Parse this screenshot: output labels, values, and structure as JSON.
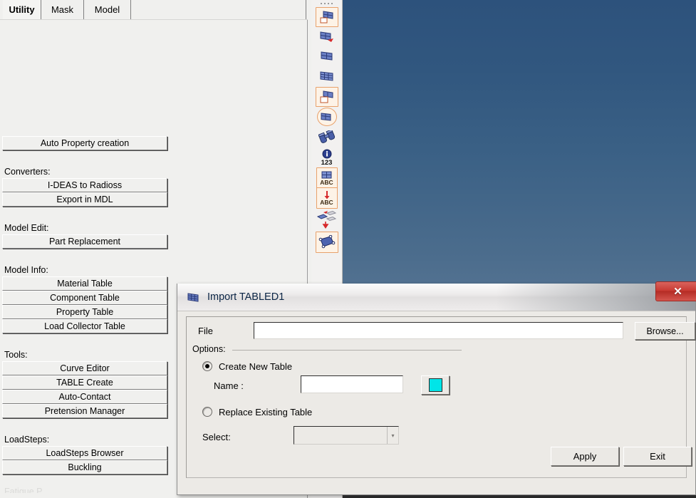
{
  "tabs": [
    {
      "label": "Utility",
      "active": true
    },
    {
      "label": "Mask",
      "active": false
    },
    {
      "label": "Model",
      "active": false
    }
  ],
  "left_panel": {
    "auto_property_button": "Auto Property creation",
    "sections": [
      {
        "label": "Converters:",
        "buttons": [
          "I-DEAS to Radioss",
          "Export in MDL"
        ]
      },
      {
        "label": "Model Edit:",
        "buttons": [
          "Part Replacement"
        ]
      },
      {
        "label": "Model Info:",
        "buttons": [
          "Material Table",
          "Component Table",
          "Property Table",
          "Load Collector Table"
        ]
      },
      {
        "label": "Tools:",
        "buttons": [
          "Curve Editor",
          "TABLE Create",
          "Auto-Contact",
          "Pretension Manager"
        ]
      },
      {
        "label": "LoadSteps:",
        "buttons": [
          "LoadSteps Browser",
          "Buckling"
        ]
      }
    ],
    "clipped_section_label": "Fatigue P"
  },
  "toolbar": {
    "items": [
      {
        "name": "table-create-icon"
      },
      {
        "name": "table-import-icon"
      },
      {
        "name": "table-edit-icon"
      },
      {
        "name": "table-grid-icon"
      },
      {
        "name": "table-delete-icon"
      },
      {
        "name": "table-review-icon"
      },
      {
        "name": "binoculars-icon"
      },
      {
        "name": "info-123-icon"
      },
      {
        "name": "abc-label-icon"
      },
      {
        "name": "abc-arrow-icon"
      },
      {
        "name": "transform-icon"
      },
      {
        "name": "quad-element-icon"
      }
    ],
    "info_number_label": "123",
    "abc_label": "ABC"
  },
  "dialog": {
    "title": "Import TABLED1",
    "title_icon": "table-grid-icon",
    "close_label": "✕",
    "file": {
      "label": "File",
      "value": "",
      "placeholder": "",
      "browse_label": "Browse..."
    },
    "options": {
      "group_label": "Options:",
      "create_new": {
        "label": "Create New Table",
        "selected": true,
        "name_label": "Name :",
        "name_value": "",
        "swatch_color": "#00e5e8"
      },
      "replace_existing": {
        "label": "Replace Existing Table",
        "selected": false,
        "select_label": "Select:",
        "select_value": "",
        "select_arrow": "▾"
      }
    },
    "footer": {
      "apply_label": "Apply",
      "exit_label": "Exit"
    }
  },
  "colors": {
    "accent_cyan": "#00e5e8",
    "close_red": "#c93b34",
    "viewport_top": "#2d527c",
    "viewport_bottom": "#828fa0",
    "toolbar_frame": "#e8a16a"
  }
}
